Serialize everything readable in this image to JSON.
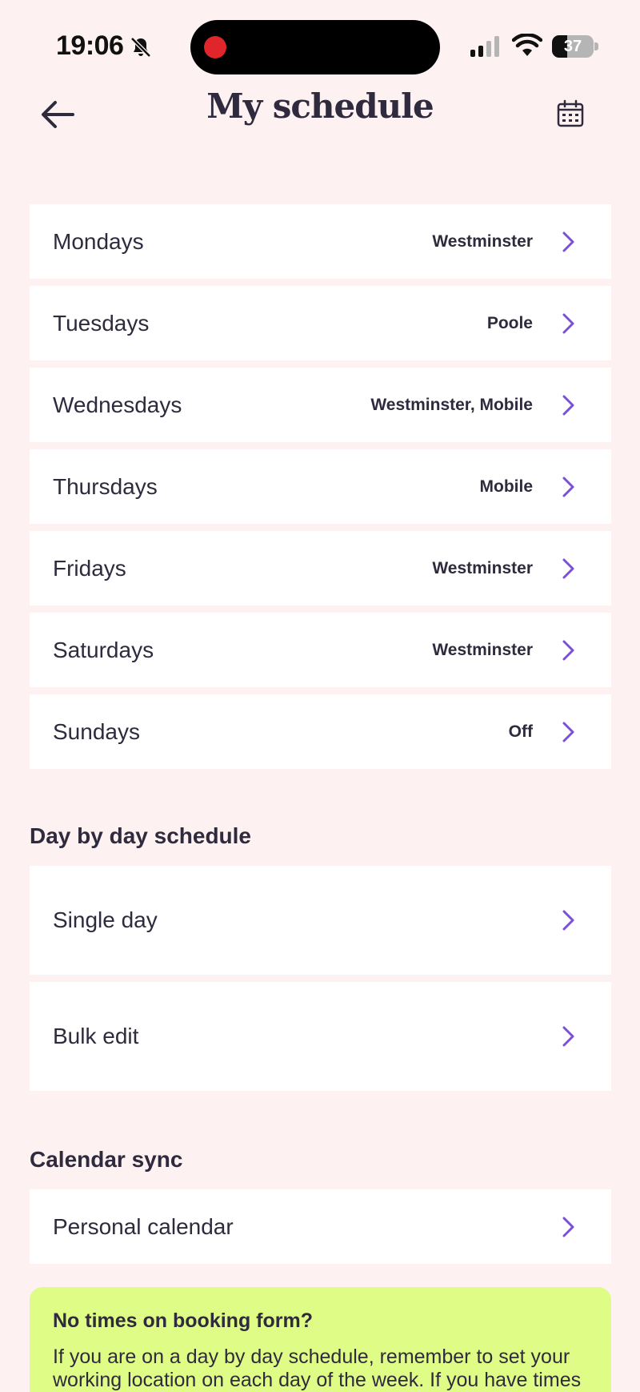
{
  "status_bar": {
    "time": "19:06",
    "battery_level": 37,
    "battery_text": "37",
    "recording_color": "#e0252b"
  },
  "header": {
    "title": "My schedule",
    "back_icon": "arrow-left-icon",
    "calendar_icon": "calendar-icon"
  },
  "weekly_schedule": [
    {
      "day": "Mondays",
      "location": "Westminster"
    },
    {
      "day": "Tuesdays",
      "location": "Poole"
    },
    {
      "day": "Wednesdays",
      "location": "Westminster, Mobile"
    },
    {
      "day": "Thursdays",
      "location": "Mobile"
    },
    {
      "day": "Fridays",
      "location": "Westminster"
    },
    {
      "day": "Saturdays",
      "location": "Westminster"
    },
    {
      "day": "Sundays",
      "location": "Off"
    }
  ],
  "day_by_day": {
    "title": "Day by day schedule",
    "items": [
      {
        "label": "Single day"
      },
      {
        "label": "Bulk edit"
      }
    ]
  },
  "calendar_sync": {
    "title": "Calendar sync",
    "items": [
      {
        "label": "Personal calendar"
      }
    ]
  },
  "info_card": {
    "title": "No times on booking form?",
    "body": "If you are on a day by day schedule, remember to set your working location on each day of the week. If you have times"
  },
  "colors": {
    "background": "#fdf2f1",
    "accent": "#7b4fd6",
    "text": "#2f2a3d",
    "info_card": "#dffd86"
  }
}
